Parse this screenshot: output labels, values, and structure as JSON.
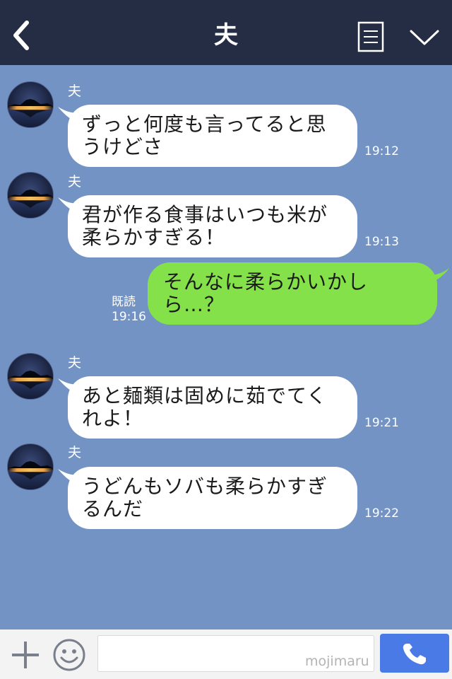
{
  "header": {
    "title": "夫"
  },
  "messages": [
    {
      "sender": "夫",
      "text": "ずっと何度も言ってると思うけどさ",
      "time": "19:12"
    },
    {
      "sender": "夫",
      "text": "君が作る食事はいつも米が柔らかすぎる！",
      "time": "19:13"
    },
    {
      "text": "そんなに柔らかいかしら…？",
      "read": "既読",
      "time": "19:16"
    },
    {
      "sender": "夫",
      "text": "あと麺類は固めに茹でてくれよ！",
      "time": "19:21"
    },
    {
      "sender": "夫",
      "text": "うどんもソバも柔らかすぎるんだ",
      "time": "19:22"
    }
  ],
  "footer": {
    "input_value": "",
    "watermark": "mojimaru"
  },
  "colors": {
    "header_bg": "#252d45",
    "chat_bg": "#7393c4",
    "sent_bubble": "#85e14a",
    "received_bubble": "#ffffff",
    "call_button": "#4a7ae5"
  },
  "icons": {
    "back": "chevron-left-icon",
    "menu": "menu-list-icon",
    "collapse": "chevron-down-icon",
    "add": "plus-icon",
    "emoji": "smiley-icon",
    "call": "phone-icon"
  }
}
